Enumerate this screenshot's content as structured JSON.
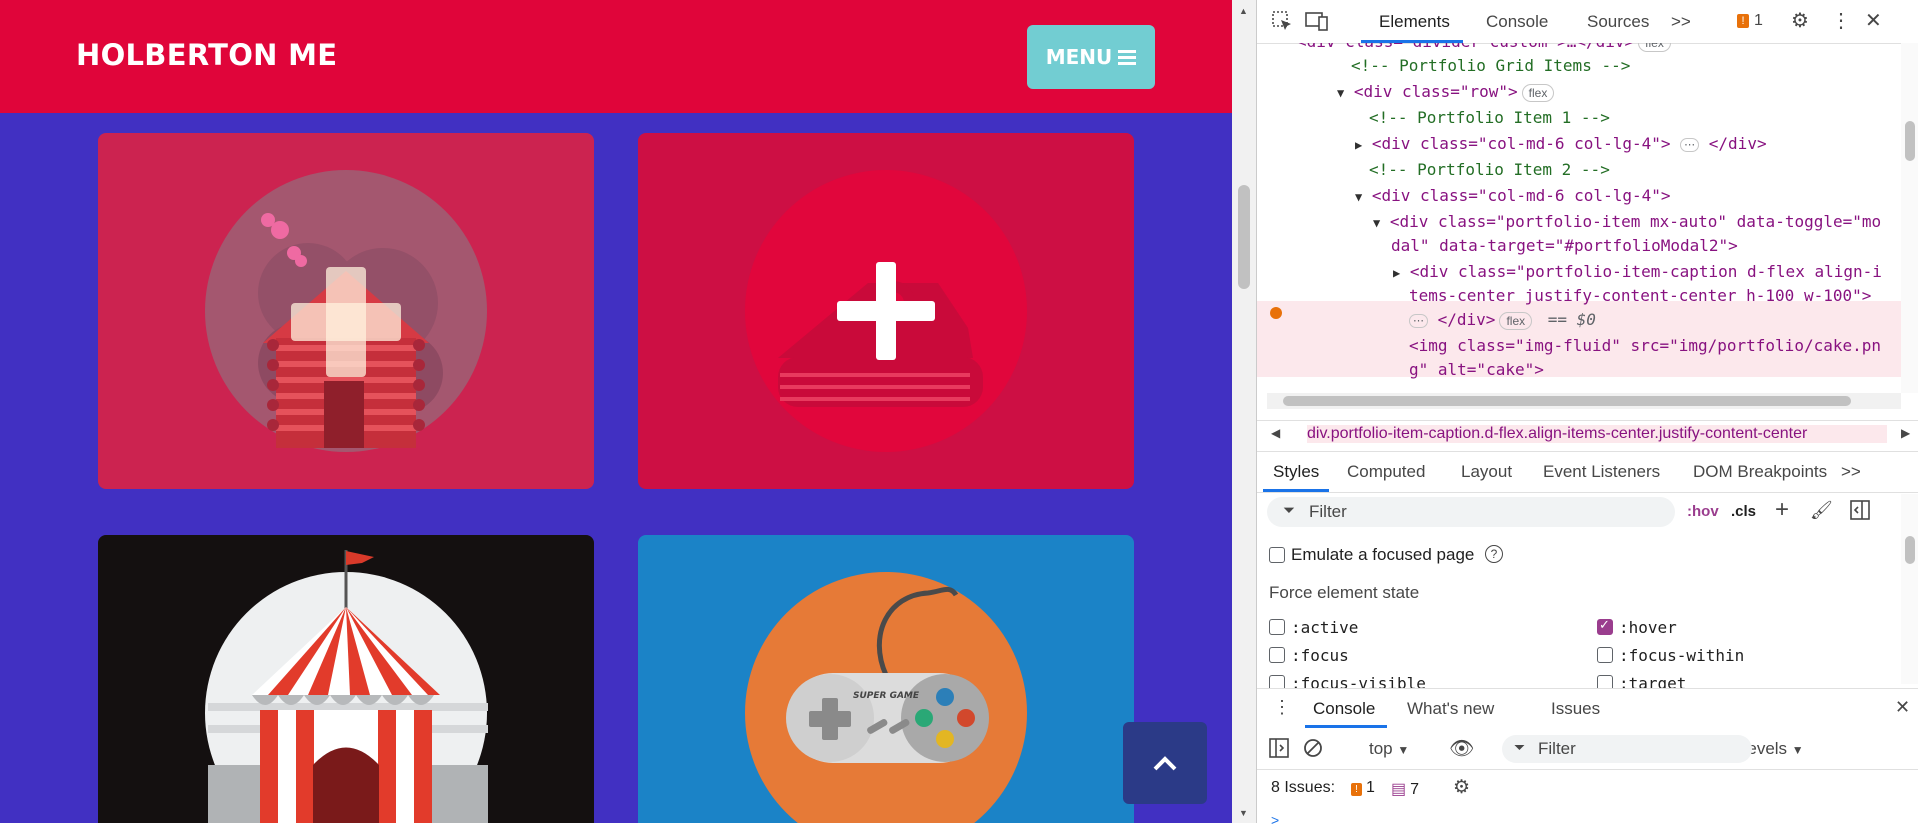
{
  "page": {
    "brand": "HOLBERTON ME",
    "menu_label": "MENU",
    "menu_icon": "hamburger-icon",
    "tiles": [
      {
        "name": "log-cabin",
        "bg": "#cc2350",
        "circle": "#a4576f"
      },
      {
        "name": "cake",
        "bg": "#cd0f44",
        "circle": "#e1063c"
      },
      {
        "name": "circus-tent",
        "bg": "#141010",
        "circle": "#eef0f1"
      },
      {
        "name": "game-controller",
        "bg": "#1b83c7",
        "circle": "#e67a37"
      }
    ],
    "overlay_icon": "plus-icon",
    "controller_label": "SUPER GAME",
    "scroll_top_icon": "chevron-up-icon",
    "colors": {
      "navbar": "#e0053a",
      "background": "#4130c2",
      "menu_button": "#72cdd2",
      "scroll_top": "#2b3a87"
    }
  },
  "devtools": {
    "tabs": [
      "Elements",
      "Console",
      "Sources"
    ],
    "active_tab": "Elements",
    "more_tabs": ">>",
    "issues_count": "1",
    "tree": {
      "top_partial": "<div class=\"divider-custom\">…</div>",
      "top_partial_pill": "flex",
      "comment_grid": "<!-- Portfolio Grid Items -->",
      "row_tag": "<div class=\"row\">",
      "row_pill": "flex",
      "comment_item1": "<!-- Portfolio Item 1 -->",
      "item1_open": "<div class=\"col-md-6 col-lg-4\">",
      "item1_close": "</div>",
      "comment_item2": "<!-- Portfolio Item 2 -->",
      "item2_open": "<div class=\"col-md-6 col-lg-4\">",
      "portfolio_line1": "<div class=\"portfolio-item mx-auto\" data-toggle=\"mo",
      "portfolio_line2": "dal\" data-target=\"#portfolioModal2\">",
      "caption_line1": "<div class=\"portfolio-item-caption d-flex align-i",
      "caption_line2": "tems-center justify-content-center h-100 w-100\">",
      "caption_close": "</div>",
      "caption_pill": "flex",
      "caption_eq": "== $0",
      "img_line1": "<img class=\"img-fluid\" src=\"img/portfolio/cake.pn",
      "img_line2": "g\" alt=\"cake\">"
    },
    "breadcrumb": "div.portfolio-item-caption.d-flex.align-items-center.justify-content-center",
    "styles_tabs": [
      "Styles",
      "Computed",
      "Layout",
      "Event Listeners",
      "DOM Breakpoints"
    ],
    "styles_more": ">>",
    "filter_placeholder": "Filter",
    "hov": ":hov",
    "cls": ".cls",
    "emulate_focus": "Emulate a focused page",
    "force_state_label": "Force element state",
    "states": [
      {
        "label": ":active",
        "checked": false
      },
      {
        "label": ":hover",
        "checked": true
      },
      {
        "label": ":focus",
        "checked": false
      },
      {
        "label": ":focus-within",
        "checked": false
      },
      {
        "label": ":focus-visible",
        "checked": false
      },
      {
        "label": ":target",
        "checked": false
      }
    ],
    "drawer_tabs": [
      "Console",
      "What's new",
      "Issues"
    ],
    "console": {
      "context": "top",
      "filter_placeholder": "Filter",
      "levels": "Default levels",
      "issues_label": "8 Issues:",
      "issues_warn": "1",
      "issues_info": "7"
    },
    "prompt": ">"
  }
}
